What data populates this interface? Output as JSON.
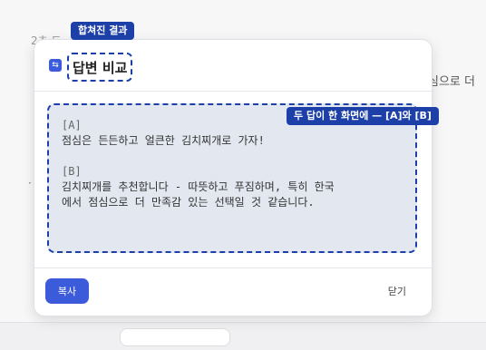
{
  "background": {
    "left_fragment": "2초 드",
    "right_fragment": "심으로 더",
    "bullet": "·"
  },
  "dialog": {
    "title": "답변 비교",
    "title_icon": "compare-icon",
    "answer_a_tag": "[A]",
    "answer_a": "점심은 든든하고 얼큰한 김치찌개로 가자!",
    "answer_b_tag": "[B]",
    "answer_b_line1": "김치찌개를 추천합니다 - 따뜻하고 푸짐하며, 특히 한국",
    "answer_b_line2": "에서 점심으로 더 만족감 있는 선택일 것 같습니다.",
    "copy_label": "복사",
    "close_label": "닫기"
  },
  "annotations": {
    "merged_result": "합쳐진 결과",
    "both_answers": "두 답이 한 화면에 — [A]와 [B]"
  },
  "colors": {
    "accent": "#3b5bdb",
    "annotation": "#1c3fa8",
    "content_bg": "#e3e7f0"
  }
}
